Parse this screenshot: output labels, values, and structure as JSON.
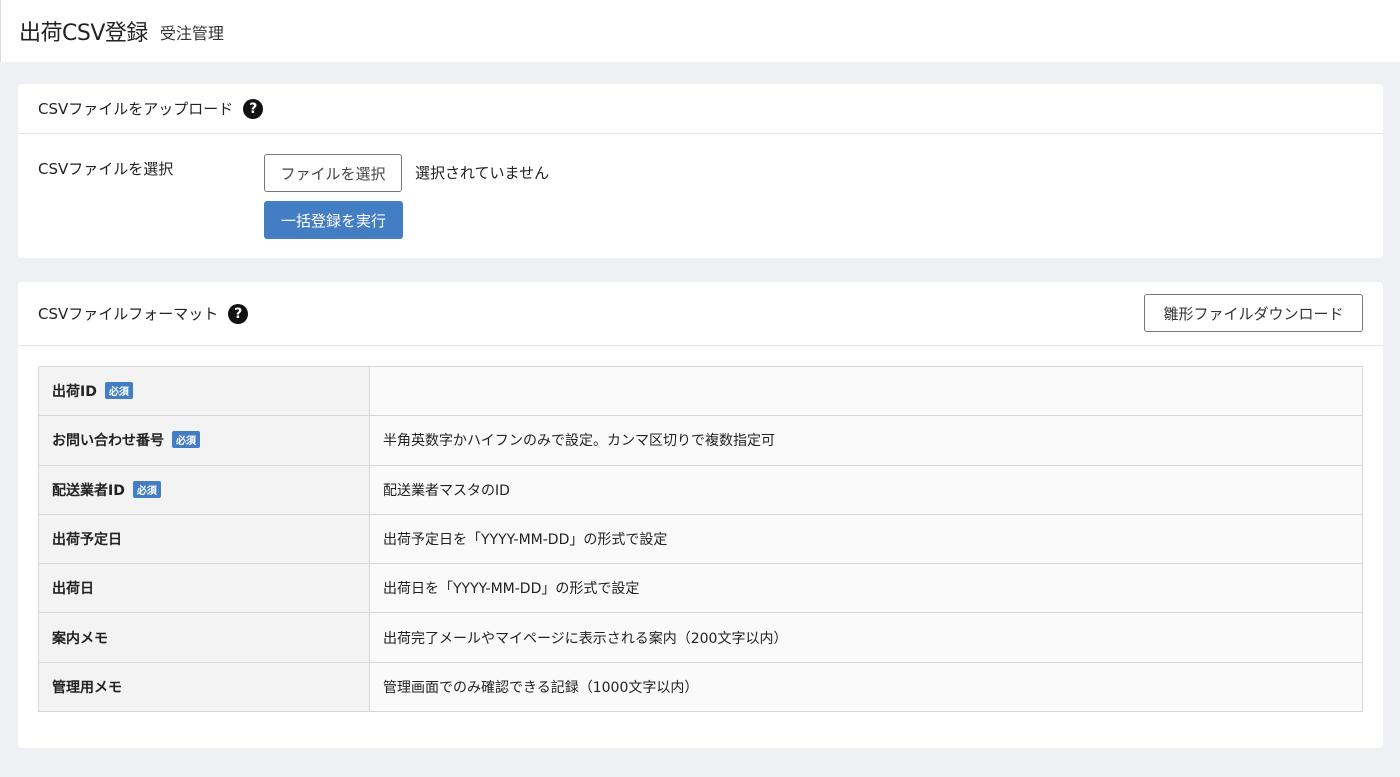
{
  "header": {
    "title": "出荷CSV登録",
    "subtitle": "受注管理"
  },
  "upload": {
    "title": "CSVファイルをアップロード",
    "help_icon": "question-circle-icon",
    "field_label": "CSVファイルを選択",
    "file_button_label": "ファイルを選択",
    "file_status": "選択されていません",
    "run_button_label": "一括登録を実行"
  },
  "format": {
    "title": "CSVファイルフォーマット",
    "help_icon": "question-circle-icon",
    "download_button_label": "雛形ファイルダウンロード",
    "required_badge": "必須",
    "rows": [
      {
        "key": "出荷ID",
        "required": true,
        "desc": ""
      },
      {
        "key": "お問い合わせ番号",
        "required": true,
        "desc": "半角英数字かハイフンのみで設定。カンマ区切りで複数指定可"
      },
      {
        "key": "配送業者ID",
        "required": true,
        "desc": "配送業者マスタのID"
      },
      {
        "key": "出荷予定日",
        "required": false,
        "desc": "出荷予定日を「YYYY-MM-DD」の形式で設定"
      },
      {
        "key": "出荷日",
        "required": false,
        "desc": "出荷日を「YYYY-MM-DD」の形式で設定"
      },
      {
        "key": "案内メモ",
        "required": false,
        "desc": "出荷完了メールやマイページに表示される案内（200文字以内）"
      },
      {
        "key": "管理用メモ",
        "required": false,
        "desc": "管理画面でのみ確認できる記録（1000文字以内）"
      }
    ]
  },
  "colors": {
    "primary": "#437ec4",
    "background": "#eef0f4"
  }
}
